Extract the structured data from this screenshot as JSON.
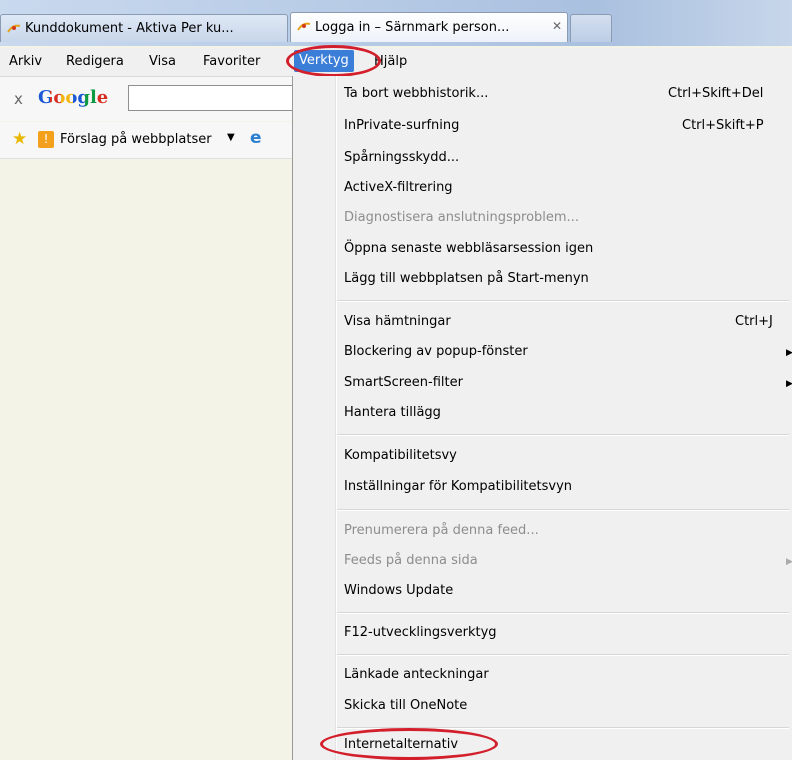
{
  "tabs": [
    {
      "title": "Kunddokument - Aktiva Per ku...",
      "active": false
    },
    {
      "title": "Logga in – Särnmark person...",
      "active": true,
      "close": "✕"
    },
    {
      "title": "",
      "active": false
    }
  ],
  "menubar": {
    "items": [
      "Arkiv",
      "Redigera",
      "Visa",
      "Favoriter",
      "Verktyg",
      "Hjälp"
    ],
    "active": "Verktyg"
  },
  "toolbar": {
    "close_glyph": "x",
    "google_logo": "Google",
    "search_value": ""
  },
  "favorites": {
    "suggested_sites": "Förslag på webbplatser",
    "dropdown_glyph": "▼"
  },
  "tools_menu": {
    "groups": [
      [
        {
          "label": "Ta bort webbhistorik...",
          "shortcut": "Ctrl+Skift+Del"
        },
        {
          "label": "InPrivate-surfning",
          "shortcut": "Ctrl+Skift+P"
        },
        {
          "label": "Spårningsskydd..."
        },
        {
          "label": "ActiveX-filtrering"
        },
        {
          "label": "Diagnostisera anslutningsproblem...",
          "disabled": true
        },
        {
          "label": "Öppna senaste webbläsarsession igen"
        },
        {
          "label": "Lägg till webbplatsen på Start-menyn"
        }
      ],
      [
        {
          "label": "Visa hämtningar",
          "shortcut": "Ctrl+J"
        },
        {
          "label": "Blockering av popup-fönster",
          "submenu": true
        },
        {
          "label": "SmartScreen-filter",
          "submenu": true
        },
        {
          "label": "Hantera tillägg"
        }
      ],
      [
        {
          "label": "Kompatibilitetsvy"
        },
        {
          "label": "Inställningar för Kompatibilitetsvyn"
        }
      ],
      [
        {
          "label": "Prenumerera på denna feed...",
          "disabled": true
        },
        {
          "label": "Feeds på denna sida",
          "disabled": true,
          "submenu": true
        },
        {
          "label": "Windows Update"
        }
      ],
      [
        {
          "label": "F12-utvecklingsverktyg"
        }
      ],
      [
        {
          "label": "Länkade anteckningar"
        },
        {
          "label": "Skicka till OneNote"
        }
      ],
      [
        {
          "label": "Internetalternativ"
        }
      ]
    ],
    "submenu_glyph": "▶"
  },
  "colors": {
    "highlight": "#3b7ed8",
    "annotation": "#d21f2b",
    "disabled_text": "#8d8d8d"
  }
}
